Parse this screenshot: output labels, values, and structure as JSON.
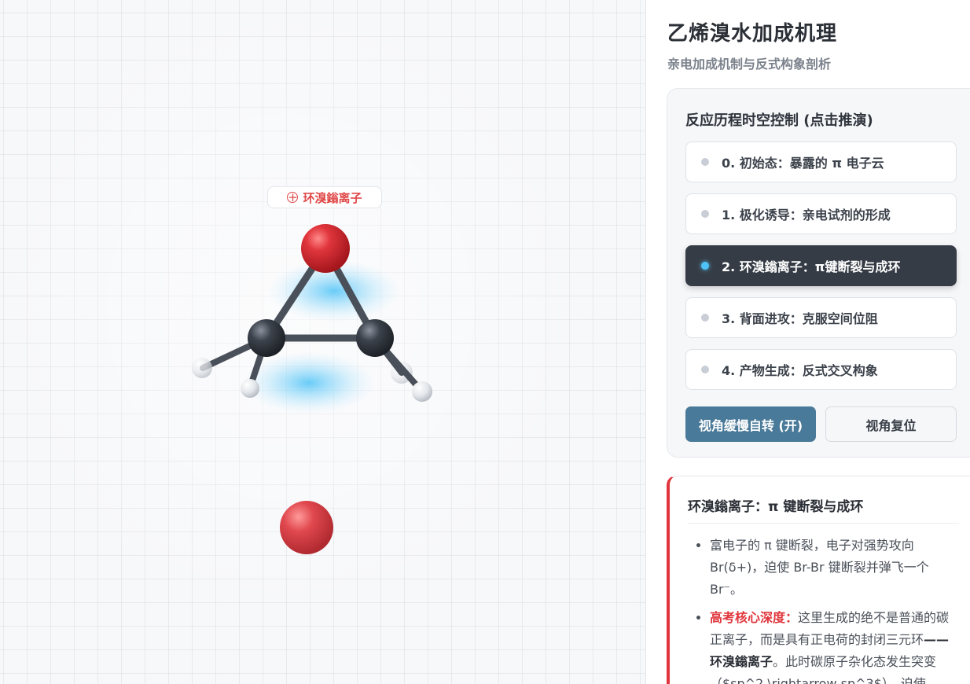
{
  "scene": {
    "ion_label": "环溴鎓离子",
    "ion_label_icon": "plus-circle-icon",
    "atom_colors": {
      "bromine": "#d0333a",
      "carbon": "#3c424b",
      "hydrogen": "#e6e8ec",
      "pi_cloud": "#4fc3f7",
      "bond": "#4a5059"
    }
  },
  "panel": {
    "title": "乙烯溴水加成机理",
    "subtitle": "亲电加成机制与反式构象剖析",
    "timeline": {
      "heading": "反应历程时空控制 (点击推演)",
      "steps": [
        {
          "label": "0. 初始态：暴露的 π 电子云"
        },
        {
          "label": "1. 极化诱导：亲电试剂的形成"
        },
        {
          "label": "2. 环溴鎓离子：π键断裂与成环"
        },
        {
          "label": "3. 背面进攻：克服空间位阻"
        },
        {
          "label": "4. 产物生成：反式交叉构象"
        }
      ],
      "active_step": 2
    },
    "buttons": {
      "rotate": "视角缓慢自转 (开)",
      "reset": "视角复位"
    },
    "detail": {
      "title": "环溴鎓离子：π 键断裂与成环",
      "items": [
        {
          "text": "富电子的 π 键断裂，电子对强势攻向 Br(δ+)，迫使 Br-Br 键断裂并弹飞一个 Br⁻。"
        },
        {
          "highlight": "高考核心深度：",
          "text": "这里生成的绝不是普通的碳正离子，而是具有正电荷的封闭三元环",
          "strong": "——环溴鎓离子",
          "tail": "。此时碳原子杂化态发生突变（$sp^2 \\rightarrow sp^3$），迫使"
        }
      ]
    },
    "colors": {
      "accent_red": "#e0353c",
      "active_bg": "#363c45",
      "button_blue": "#4a7a99"
    }
  }
}
